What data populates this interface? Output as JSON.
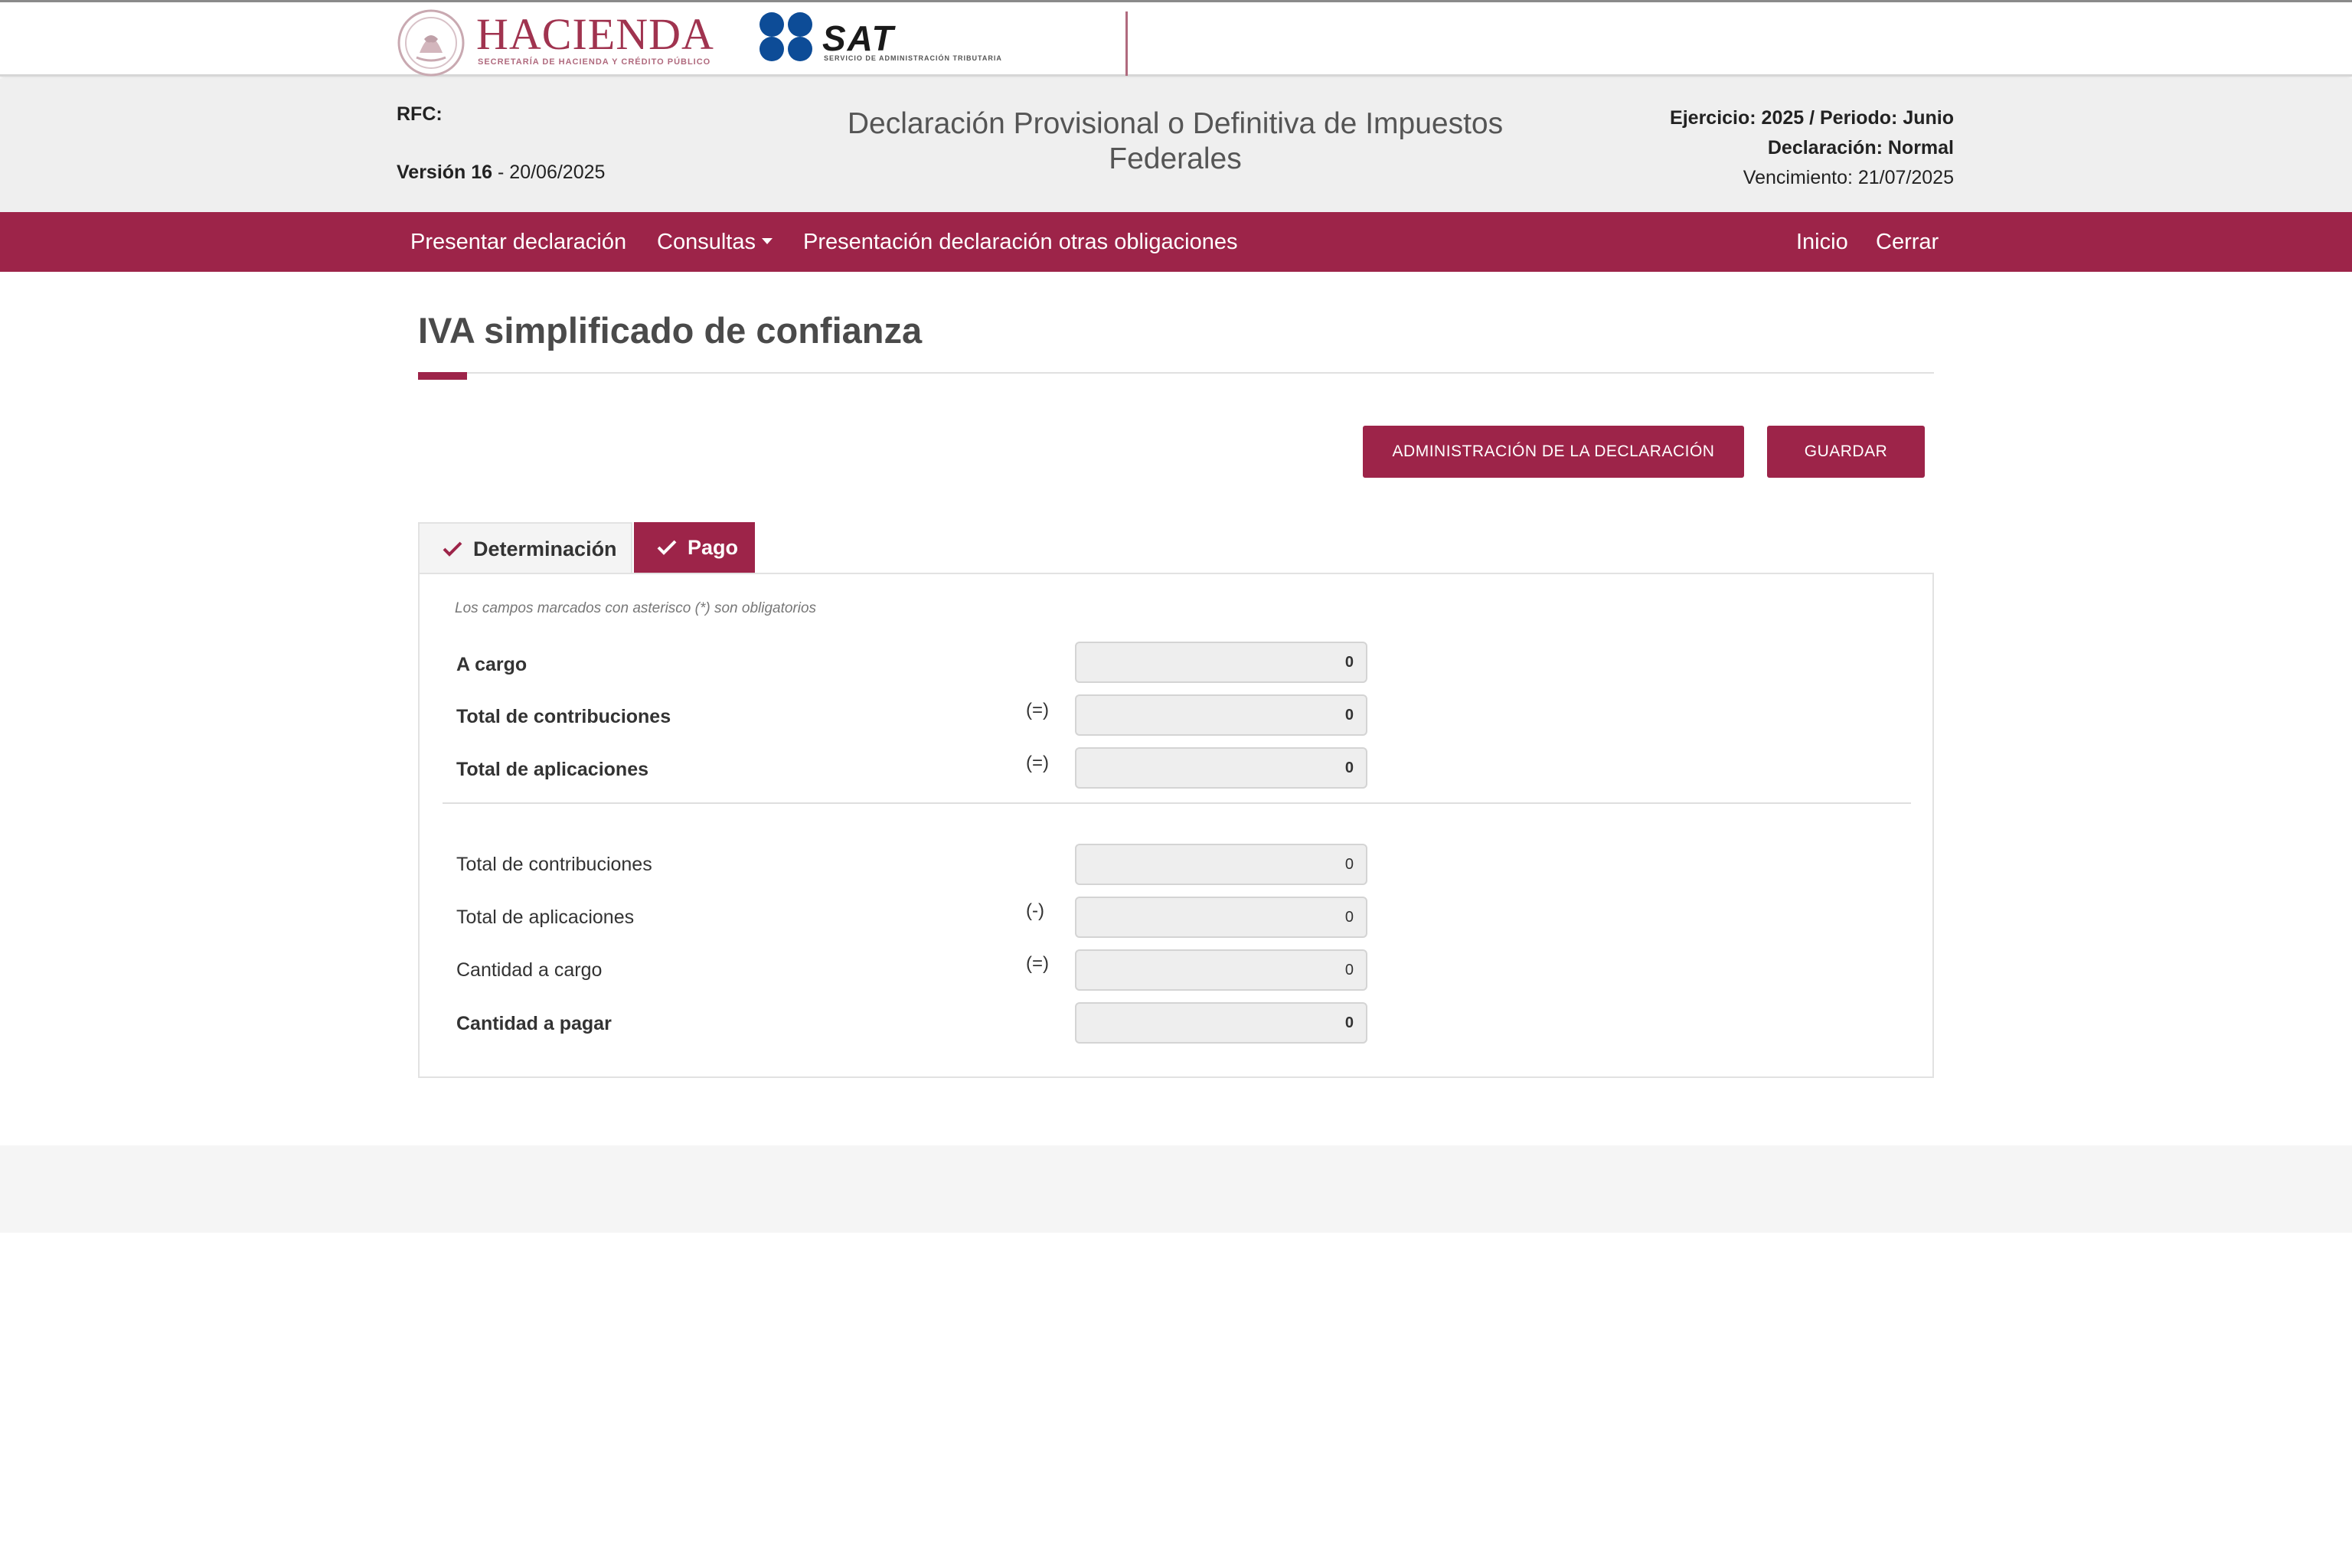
{
  "logos": {
    "hacienda_name": "HACIENDA",
    "hacienda_subtitle": "SECRETARÍA DE HACIENDA Y CRÉDITO PÚBLICO",
    "sat_name": "SAT",
    "sat_subtitle": "SERVICIO DE ADMINISTRACIÓN TRIBUTARIA"
  },
  "header": {
    "rfc_label": "RFC:",
    "version_label": "Versión 16",
    "version_date": " - 20/06/2025",
    "title": "Declaración Provisional o Definitiva de Impuestos Federales",
    "ejercicio_periodo": "Ejercicio: 2025 / Periodo: Junio",
    "declaracion": "Declaración: Normal",
    "vencimiento": "Vencimiento: 21/07/2025"
  },
  "nav": {
    "presentar": "Presentar declaración",
    "consultas": "Consultas",
    "otras_obligaciones": "Presentación declaración otras obligaciones",
    "inicio": "Inicio",
    "cerrar": "Cerrar"
  },
  "page": {
    "section_title": "IVA simplificado de confianza",
    "admin_button": "ADMINISTRACIÓN DE LA DECLARACIÓN",
    "save_button": "GUARDAR"
  },
  "tabs": [
    {
      "label": "Determinación",
      "active": false
    },
    {
      "label": "Pago",
      "active": true
    }
  ],
  "form": {
    "required_note": "Los campos marcados con asterisco (*) son obligatorios",
    "summary_rows": [
      {
        "label": "A cargo",
        "operator": "",
        "value": "0"
      },
      {
        "label": "Total de contribuciones",
        "operator": "(=)",
        "value": "0"
      },
      {
        "label": "Total de aplicaciones",
        "operator": "(=)",
        "value": "0"
      }
    ],
    "detail_rows": [
      {
        "label": "Total de contribuciones",
        "operator": "",
        "value": "0"
      },
      {
        "label": "Total de aplicaciones",
        "operator": "(-)",
        "value": "0"
      },
      {
        "label": "Cantidad a cargo",
        "operator": "(=)",
        "value": "0"
      },
      {
        "label": "Cantidad a pagar",
        "operator": "",
        "value": "0"
      }
    ]
  },
  "colors": {
    "brand_primary": "#9d2449",
    "header_bg": "#efefef",
    "sat_blue": "#0d4c97"
  }
}
